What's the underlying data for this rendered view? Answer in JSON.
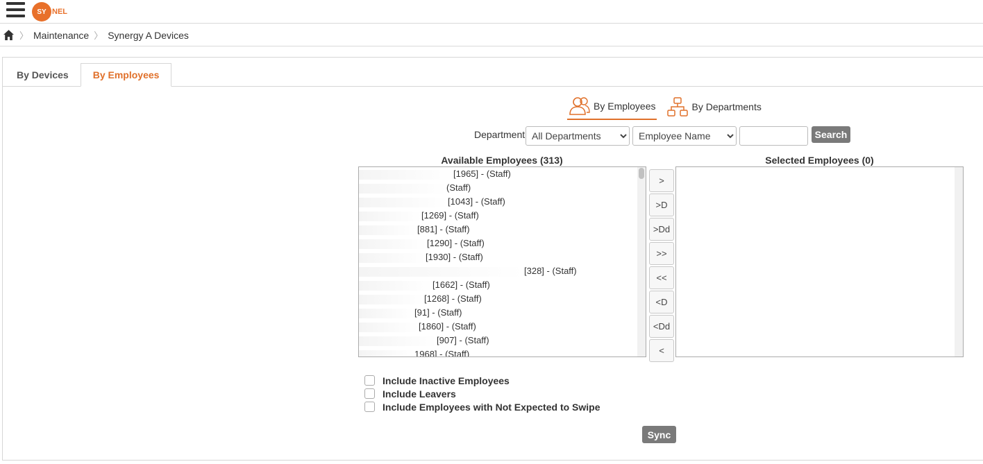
{
  "header": {
    "logo_circle": "SY",
    "logo_rest": "NEL",
    "logo_color": "#e8702a"
  },
  "breadcrumb": {
    "items": [
      "Maintenance",
      "Synergy A Devices"
    ]
  },
  "tabs": [
    {
      "label": "By Devices",
      "active": false
    },
    {
      "label": "By Employees",
      "active": true
    }
  ],
  "mode_switch": {
    "employees_label": "By Employees",
    "departments_label": "By Departments"
  },
  "filters": {
    "department_label": "Department",
    "department_selected": "All Departments",
    "sort_selected": "Employee Name",
    "search_value": "",
    "search_button": "Search"
  },
  "available": {
    "title": "Available Employees (313)",
    "rows": [
      {
        "text": "[1965] - (Staff)"
      },
      {
        "text": "(Staff)"
      },
      {
        "text": "[1043] - (Staff)"
      },
      {
        "text": "[1269] - (Staff)"
      },
      {
        "text": "[881] - (Staff)"
      },
      {
        "text": "[1290] - (Staff)"
      },
      {
        "text": "[1930] - (Staff)"
      },
      {
        "text": "[328] - (Staff)"
      },
      {
        "text": "[1662] - (Staff)"
      },
      {
        "text": "[1268] - (Staff)"
      },
      {
        "text": "[91] - (Staff)"
      },
      {
        "text": "[1860] - (Staff)"
      },
      {
        "text": "[907] - (Staff)"
      },
      {
        "text": "1968] - (Staff)"
      }
    ]
  },
  "selected": {
    "title": "Selected Employees (0)"
  },
  "arrows": [
    ">",
    ">D",
    ">Dd",
    ">>",
    "<<",
    "<D",
    "<Dd",
    "<"
  ],
  "checkboxes": [
    {
      "label": "Include Inactive Employees",
      "checked": false
    },
    {
      "label": "Include Leavers",
      "checked": false
    },
    {
      "label": "Include Employees with Not Expected to Swipe",
      "checked": false
    }
  ],
  "sync_button": "Sync",
  "colors": {
    "accent": "#e0702a",
    "button_grey": "#7a7a7a"
  }
}
